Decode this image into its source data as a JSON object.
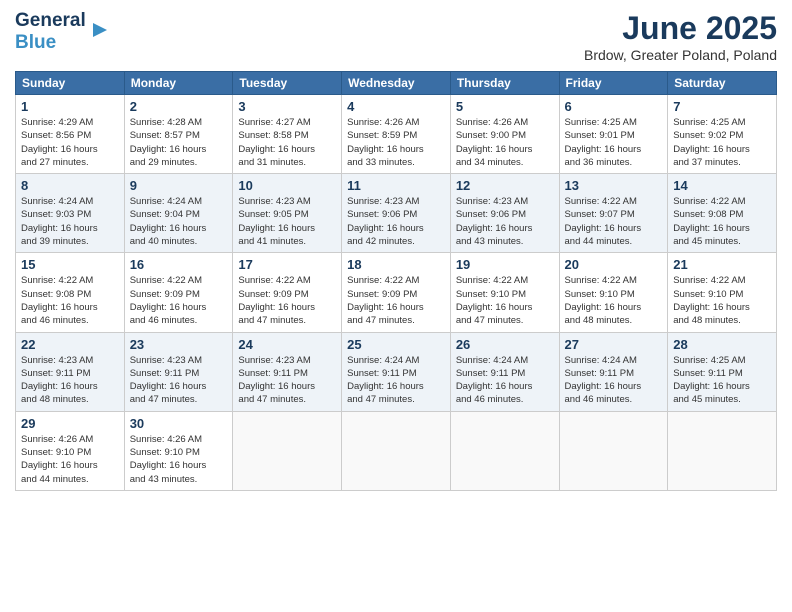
{
  "logo": {
    "text_general": "General",
    "text_blue": "Blue",
    "icon": "▶"
  },
  "title": {
    "month_year": "June 2025",
    "location": "Brdow, Greater Poland, Poland"
  },
  "columns": [
    "Sunday",
    "Monday",
    "Tuesday",
    "Wednesday",
    "Thursday",
    "Friday",
    "Saturday"
  ],
  "weeks": [
    [
      {
        "day": "1",
        "sunrise": "4:29 AM",
        "sunset": "8:56 PM",
        "daylight": "16 hours and 27 minutes."
      },
      {
        "day": "2",
        "sunrise": "4:28 AM",
        "sunset": "8:57 PM",
        "daylight": "16 hours and 29 minutes."
      },
      {
        "day": "3",
        "sunrise": "4:27 AM",
        "sunset": "8:58 PM",
        "daylight": "16 hours and 31 minutes."
      },
      {
        "day": "4",
        "sunrise": "4:26 AM",
        "sunset": "8:59 PM",
        "daylight": "16 hours and 33 minutes."
      },
      {
        "day": "5",
        "sunrise": "4:26 AM",
        "sunset": "9:00 PM",
        "daylight": "16 hours and 34 minutes."
      },
      {
        "day": "6",
        "sunrise": "4:25 AM",
        "sunset": "9:01 PM",
        "daylight": "16 hours and 36 minutes."
      },
      {
        "day": "7",
        "sunrise": "4:25 AM",
        "sunset": "9:02 PM",
        "daylight": "16 hours and 37 minutes."
      }
    ],
    [
      {
        "day": "8",
        "sunrise": "4:24 AM",
        "sunset": "9:03 PM",
        "daylight": "16 hours and 39 minutes."
      },
      {
        "day": "9",
        "sunrise": "4:24 AM",
        "sunset": "9:04 PM",
        "daylight": "16 hours and 40 minutes."
      },
      {
        "day": "10",
        "sunrise": "4:23 AM",
        "sunset": "9:05 PM",
        "daylight": "16 hours and 41 minutes."
      },
      {
        "day": "11",
        "sunrise": "4:23 AM",
        "sunset": "9:06 PM",
        "daylight": "16 hours and 42 minutes."
      },
      {
        "day": "12",
        "sunrise": "4:23 AM",
        "sunset": "9:06 PM",
        "daylight": "16 hours and 43 minutes."
      },
      {
        "day": "13",
        "sunrise": "4:22 AM",
        "sunset": "9:07 PM",
        "daylight": "16 hours and 44 minutes."
      },
      {
        "day": "14",
        "sunrise": "4:22 AM",
        "sunset": "9:08 PM",
        "daylight": "16 hours and 45 minutes."
      }
    ],
    [
      {
        "day": "15",
        "sunrise": "4:22 AM",
        "sunset": "9:08 PM",
        "daylight": "16 hours and 46 minutes."
      },
      {
        "day": "16",
        "sunrise": "4:22 AM",
        "sunset": "9:09 PM",
        "daylight": "16 hours and 46 minutes."
      },
      {
        "day": "17",
        "sunrise": "4:22 AM",
        "sunset": "9:09 PM",
        "daylight": "16 hours and 47 minutes."
      },
      {
        "day": "18",
        "sunrise": "4:22 AM",
        "sunset": "9:09 PM",
        "daylight": "16 hours and 47 minutes."
      },
      {
        "day": "19",
        "sunrise": "4:22 AM",
        "sunset": "9:10 PM",
        "daylight": "16 hours and 47 minutes."
      },
      {
        "day": "20",
        "sunrise": "4:22 AM",
        "sunset": "9:10 PM",
        "daylight": "16 hours and 48 minutes."
      },
      {
        "day": "21",
        "sunrise": "4:22 AM",
        "sunset": "9:10 PM",
        "daylight": "16 hours and 48 minutes."
      }
    ],
    [
      {
        "day": "22",
        "sunrise": "4:23 AM",
        "sunset": "9:11 PM",
        "daylight": "16 hours and 48 minutes."
      },
      {
        "day": "23",
        "sunrise": "4:23 AM",
        "sunset": "9:11 PM",
        "daylight": "16 hours and 47 minutes."
      },
      {
        "day": "24",
        "sunrise": "4:23 AM",
        "sunset": "9:11 PM",
        "daylight": "16 hours and 47 minutes."
      },
      {
        "day": "25",
        "sunrise": "4:24 AM",
        "sunset": "9:11 PM",
        "daylight": "16 hours and 47 minutes."
      },
      {
        "day": "26",
        "sunrise": "4:24 AM",
        "sunset": "9:11 PM",
        "daylight": "16 hours and 46 minutes."
      },
      {
        "day": "27",
        "sunrise": "4:24 AM",
        "sunset": "9:11 PM",
        "daylight": "16 hours and 46 minutes."
      },
      {
        "day": "28",
        "sunrise": "4:25 AM",
        "sunset": "9:11 PM",
        "daylight": "16 hours and 45 minutes."
      }
    ],
    [
      {
        "day": "29",
        "sunrise": "4:26 AM",
        "sunset": "9:10 PM",
        "daylight": "16 hours and 44 minutes."
      },
      {
        "day": "30",
        "sunrise": "4:26 AM",
        "sunset": "9:10 PM",
        "daylight": "16 hours and 43 minutes."
      },
      null,
      null,
      null,
      null,
      null
    ]
  ]
}
